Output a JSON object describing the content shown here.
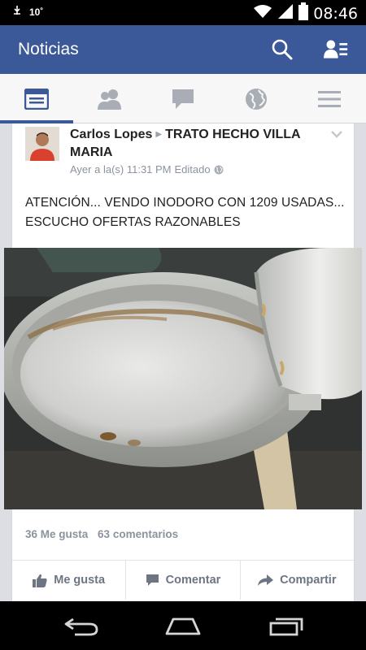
{
  "status_bar": {
    "notification": "10˚",
    "time": "08:46"
  },
  "app_bar": {
    "title": "Noticias"
  },
  "tabs": [
    {
      "name": "news-feed",
      "active": true
    },
    {
      "name": "friend-requests",
      "active": false
    },
    {
      "name": "messages",
      "active": false
    },
    {
      "name": "notifications",
      "active": false
    },
    {
      "name": "more",
      "active": false
    }
  ],
  "post": {
    "author": "Carlos Lopes",
    "target_group": "TRATO HECHO VILLA MARIA",
    "timestamp": "Ayer a la(s) 11:31 PM",
    "edited": "Editado",
    "text": "ATENCIÓN... VENDO INODORO CON 1209 USADAS... ESCUCHO OFERTAS RAZONABLES",
    "likes": "36 Me gusta",
    "comments": "63 comentarios"
  },
  "actions": {
    "like": "Me gusta",
    "comment": "Comentar",
    "share": "Compartir"
  },
  "colors": {
    "brand": "#3b5998",
    "meta": "#8b939f"
  }
}
